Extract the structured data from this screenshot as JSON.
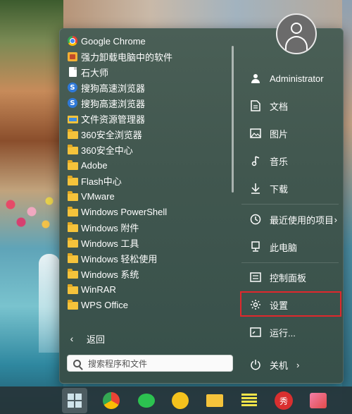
{
  "start_menu": {
    "apps": [
      {
        "label": "Google Chrome",
        "icon": "chrome-icon"
      },
      {
        "label": "强力卸载电脑中的软件",
        "icon": "uninstaller-icon"
      },
      {
        "label": "石大师",
        "icon": "document-icon"
      },
      {
        "label": "搜狗高速浏览器",
        "icon": "sogou-browser-icon"
      },
      {
        "label": "搜狗高速浏览器",
        "icon": "sogou-browser-icon"
      },
      {
        "label": "文件资源管理器",
        "icon": "file-explorer-icon"
      },
      {
        "label": "360安全浏览器",
        "icon": "folder-icon"
      },
      {
        "label": "360安全中心",
        "icon": "folder-icon"
      },
      {
        "label": "Adobe",
        "icon": "folder-icon"
      },
      {
        "label": "Flash中心",
        "icon": "folder-icon"
      },
      {
        "label": "VMware",
        "icon": "folder-icon"
      },
      {
        "label": "Windows PowerShell",
        "icon": "folder-icon"
      },
      {
        "label": "Windows 附件",
        "icon": "folder-icon"
      },
      {
        "label": "Windows 工具",
        "icon": "folder-icon"
      },
      {
        "label": "Windows 轻松使用",
        "icon": "folder-icon"
      },
      {
        "label": "Windows 系统",
        "icon": "folder-icon"
      },
      {
        "label": "WinRAR",
        "icon": "folder-icon"
      },
      {
        "label": "WPS Office",
        "icon": "folder-icon"
      }
    ],
    "back_label": "返回",
    "search_placeholder": "搜索程序和文件",
    "user_name": "Administrator",
    "right_items": {
      "documents": "文档",
      "pictures": "图片",
      "music": "音乐",
      "downloads": "下载",
      "recent": "最近使用的项目",
      "this_pc": "此电脑",
      "control_panel": "控制面板",
      "settings": "设置",
      "run": "运行...",
      "shutdown": "关机"
    },
    "highlight_color": "#e0282c"
  },
  "taskbar": {
    "icons": [
      "start-icon",
      "chrome-icon",
      "wechat-icon",
      "app-icon",
      "file-explorer-icon",
      "notes-icon",
      "sogou-red-icon",
      "photos-icon"
    ],
    "sogou_glyph": "秀"
  }
}
